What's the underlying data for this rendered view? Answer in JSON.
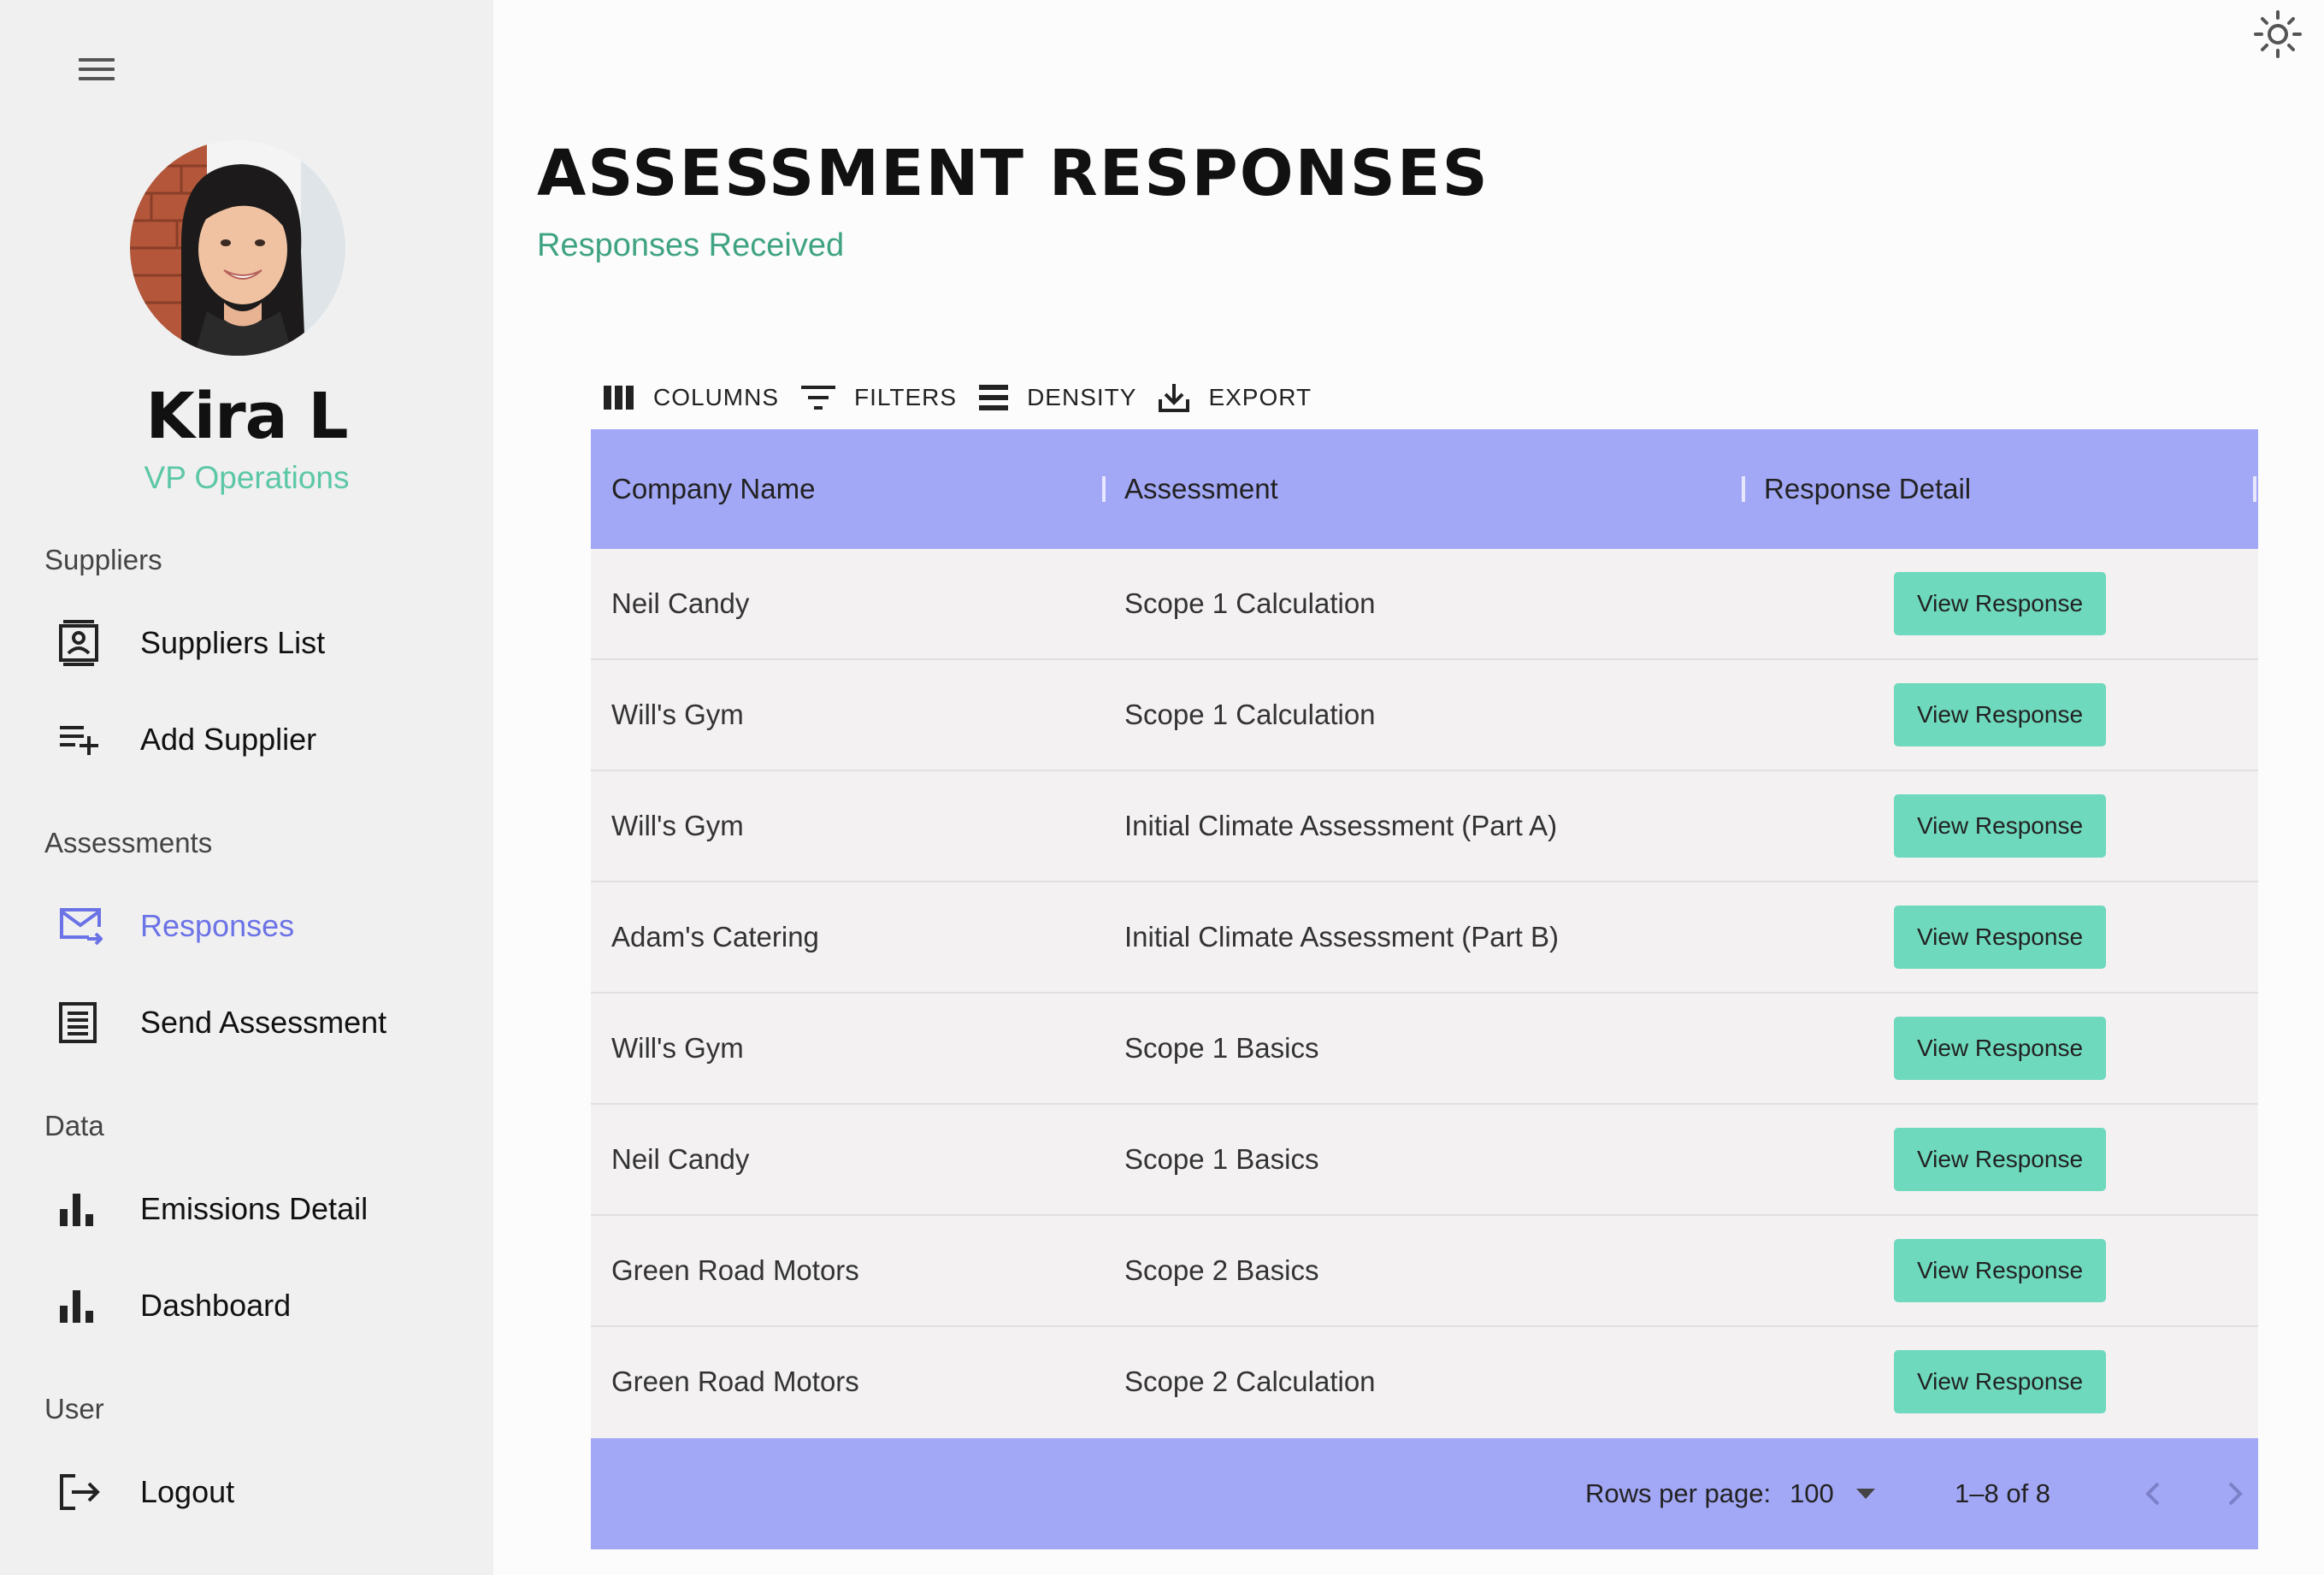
{
  "sidebar": {
    "user": {
      "name": "Kira L",
      "role": "VP Operations"
    },
    "sections": [
      {
        "label": "Suppliers",
        "items": [
          {
            "label": "Suppliers List",
            "icon": "contact-card-icon"
          },
          {
            "label": "Add Supplier",
            "icon": "playlist-add-icon"
          }
        ]
      },
      {
        "label": "Assessments",
        "items": [
          {
            "label": "Responses",
            "icon": "mail-forward-icon",
            "active": true
          },
          {
            "label": "Send Assessment",
            "icon": "receipt-icon"
          }
        ]
      },
      {
        "label": "Data",
        "items": [
          {
            "label": "Emissions Detail",
            "icon": "bar-chart-icon"
          },
          {
            "label": "Dashboard",
            "icon": "bar-chart-icon"
          }
        ]
      },
      {
        "label": "User",
        "items": [
          {
            "label": "Logout",
            "icon": "logout-icon"
          }
        ]
      }
    ]
  },
  "header": {
    "title": "ASSESSMENT RESPONSES",
    "subtitle": "Responses Received"
  },
  "toolbar": {
    "columns": "COLUMNS",
    "filters": "FILTERS",
    "density": "DENSITY",
    "export": "EXPORT"
  },
  "table": {
    "columns": [
      "Company Name",
      "Assessment",
      "Response Detail"
    ],
    "rows": [
      {
        "company": "Neil Candy",
        "assessment": "Scope 1 Calculation",
        "action": "View Response"
      },
      {
        "company": "Will's Gym",
        "assessment": "Scope 1 Calculation",
        "action": "View Response"
      },
      {
        "company": "Will's Gym",
        "assessment": "Initial Climate Assessment (Part A)",
        "action": "View Response"
      },
      {
        "company": "Adam's Catering",
        "assessment": "Initial Climate Assessment (Part B)",
        "action": "View Response"
      },
      {
        "company": "Will's Gym",
        "assessment": "Scope 1 Basics",
        "action": "View Response"
      },
      {
        "company": "Neil Candy",
        "assessment": "Scope 1 Basics",
        "action": "View Response"
      },
      {
        "company": "Green Road Motors",
        "assessment": "Scope 2 Basics",
        "action": "View Response"
      },
      {
        "company": "Green Road Motors",
        "assessment": "Scope 2 Calculation",
        "action": "View Response"
      }
    ]
  },
  "pagination": {
    "rows_per_page_label": "Rows per page:",
    "rows_per_page": "100",
    "range": "1–8 of 8"
  },
  "colors": {
    "accent": "#6b73e6",
    "header_bg": "#a3a8f6",
    "button_bg": "#6ed9bd",
    "role_text": "#5cc7a6",
    "subtitle_text": "#3fa383"
  }
}
